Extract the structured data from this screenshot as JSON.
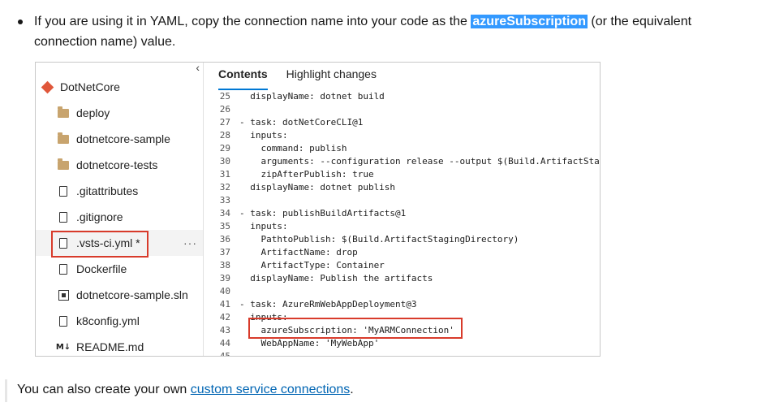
{
  "bullet": {
    "before": "If you are using it in YAML, copy the connection name into your code as the ",
    "highlight": "azureSubscription",
    "after": " (or the equivalent connection name) value."
  },
  "tree": {
    "collapse_glyph": "‹",
    "repo": "DotNetCore",
    "items": [
      {
        "label": "deploy",
        "icon": "folder-icon"
      },
      {
        "label": "dotnetcore-sample",
        "icon": "folder-icon"
      },
      {
        "label": "dotnetcore-tests",
        "icon": "folder-icon"
      },
      {
        "label": ".gitattributes",
        "icon": "file-icon"
      },
      {
        "label": ".gitignore",
        "icon": "file-icon"
      },
      {
        "label": ".vsts-ci.yml *",
        "icon": "file-icon"
      },
      {
        "label": "Dockerfile",
        "icon": "file-icon"
      },
      {
        "label": "dotnetcore-sample.sln",
        "icon": "solution-file-icon"
      },
      {
        "label": "k8config.yml",
        "icon": "file-icon"
      },
      {
        "label": "README.md",
        "icon": "markdown-icon"
      }
    ],
    "more_glyph": "···",
    "markdown_glyph": "M↓"
  },
  "tabs": [
    {
      "label": "Contents",
      "active": true
    },
    {
      "label": "Highlight changes",
      "active": false
    }
  ],
  "code_lines": [
    {
      "n": "25",
      "t": "  displayName: dotnet build"
    },
    {
      "n": "26",
      "t": ""
    },
    {
      "n": "27",
      "t": "- task: dotNetCoreCLI@1"
    },
    {
      "n": "28",
      "t": "  inputs:"
    },
    {
      "n": "29",
      "t": "    command: publish"
    },
    {
      "n": "30",
      "t": "    arguments: --configuration release --output $(Build.ArtifactStag"
    },
    {
      "n": "31",
      "t": "    zipAfterPublish: true"
    },
    {
      "n": "32",
      "t": "  displayName: dotnet publish"
    },
    {
      "n": "33",
      "t": ""
    },
    {
      "n": "34",
      "t": "- task: publishBuildArtifacts@1"
    },
    {
      "n": "35",
      "t": "  inputs:"
    },
    {
      "n": "36",
      "t": "    PathtoPublish: $(Build.ArtifactStagingDirectory)"
    },
    {
      "n": "37",
      "t": "    ArtifactName: drop"
    },
    {
      "n": "38",
      "t": "    ArtifactType: Container"
    },
    {
      "n": "39",
      "t": "  displayName: Publish the artifacts"
    },
    {
      "n": "40",
      "t": ""
    },
    {
      "n": "41",
      "t": "- task: AzureRmWebAppDeployment@3"
    },
    {
      "n": "42",
      "t": "  inputs:"
    },
    {
      "n": "43",
      "t": "    azureSubscription: 'MyARMConnection'"
    },
    {
      "n": "44",
      "t": "    WebAppName: 'MyWebApp'"
    },
    {
      "n": "45",
      "t": ""
    }
  ],
  "note": {
    "before": "You can also create your own ",
    "link": "custom service connections",
    "after": "."
  },
  "colors": {
    "highlight": "#3399ff",
    "callout": "#d83b2b",
    "link": "#0065b3",
    "tab_underline": "#0078d4"
  }
}
